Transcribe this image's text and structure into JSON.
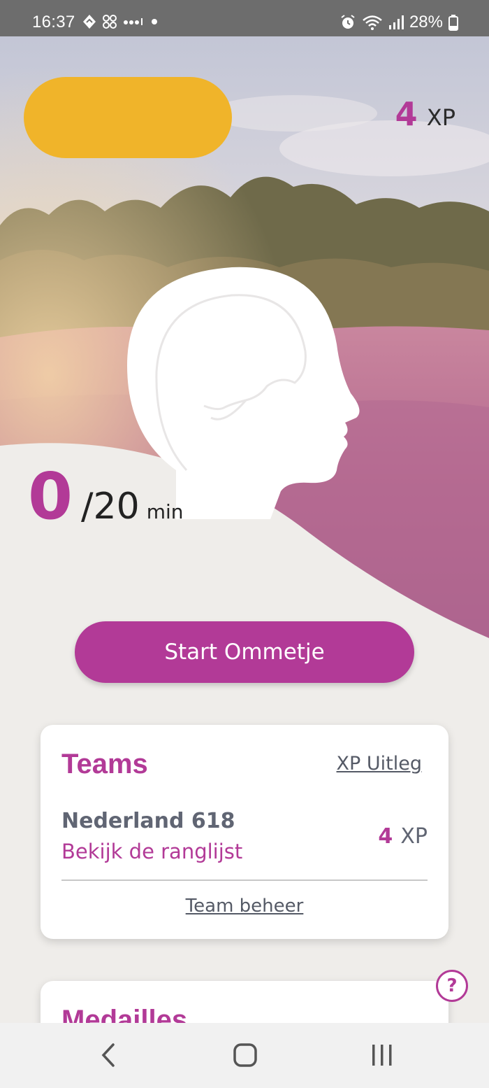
{
  "status_bar": {
    "time": "16:37",
    "battery": "28%"
  },
  "header": {
    "xp_value": "4",
    "xp_unit": "XP"
  },
  "progress": {
    "current": "0",
    "goal": "/20",
    "unit": "min"
  },
  "actions": {
    "start_label": "Start Ommetje"
  },
  "teams": {
    "title": "Teams",
    "xp_info_link": "XP Uitleg",
    "team_name": "Nederland 618",
    "ranking_link": "Bekijk de ranglijst",
    "team_xp_value": "4",
    "team_xp_unit": "XP",
    "manage_link": "Team beheer"
  },
  "medals": {
    "title": "Medailles"
  },
  "help": {
    "label": "?"
  },
  "colors": {
    "accent": "#b23a97",
    "background": "#efedea",
    "profile_blob": "#f0b42a"
  },
  "icons": {
    "status_left": [
      "navigation-icon",
      "app-icon",
      "signal-dots-icon",
      "dot-icon"
    ],
    "status_right": [
      "alarm-icon",
      "wifi-icon",
      "cell-signal-icon",
      "battery-icon"
    ],
    "nav": [
      "back-icon",
      "home-icon",
      "recents-icon"
    ],
    "hero": "head-profile-icon"
  }
}
